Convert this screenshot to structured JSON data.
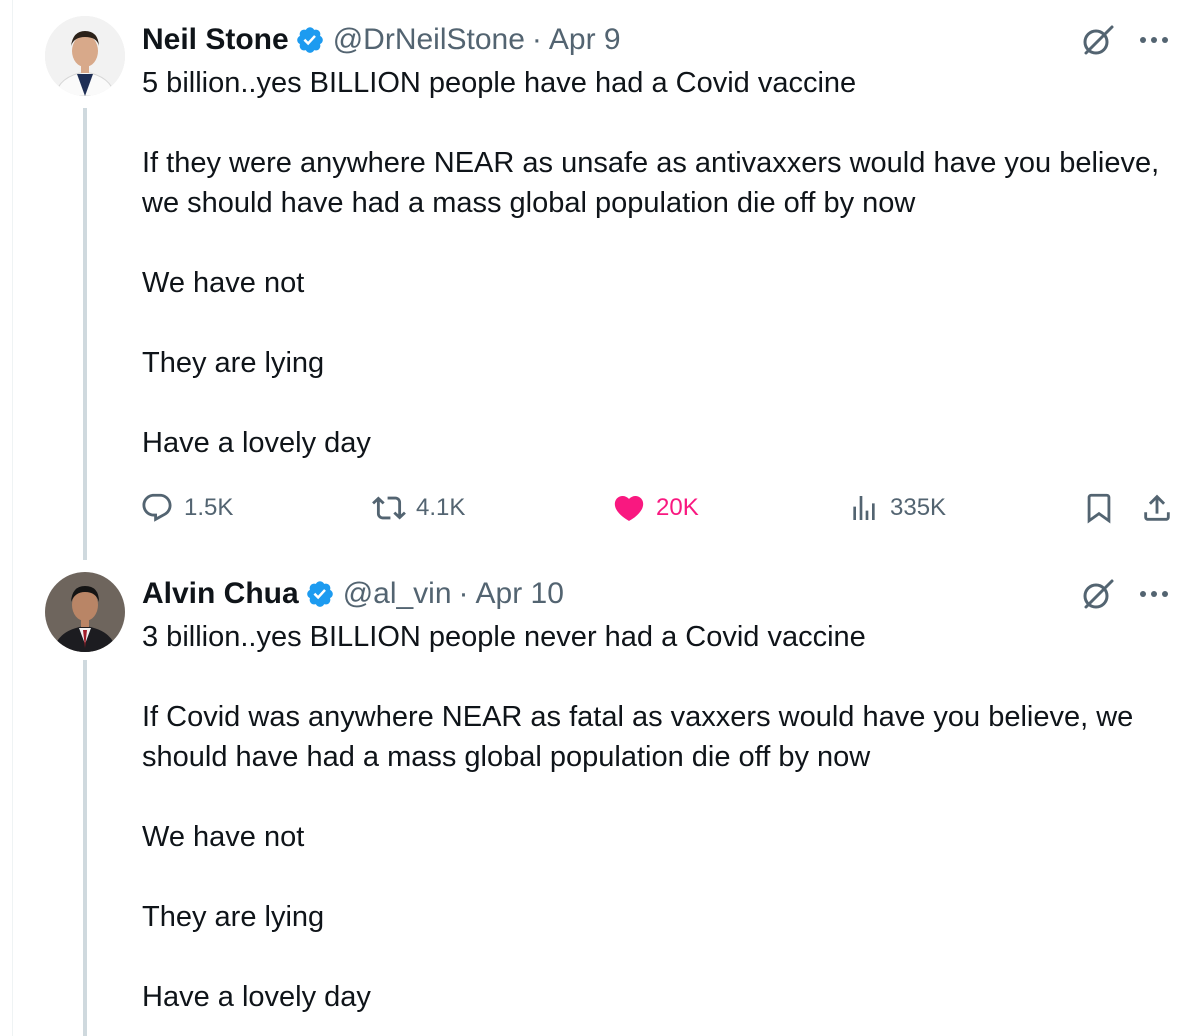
{
  "tweets": [
    {
      "author": {
        "name": "Neil Stone",
        "handle": "@DrNeilStone",
        "verified": true
      },
      "date": "Apr 9",
      "text": "5 billion..yes BILLION people have had a Covid vaccine\n\nIf they were anywhere NEAR as unsafe as antivaxxers would have you believe, we should have had a mass global population die off by now\n\nWe have not\n\nThey are lying\n\nHave a lovely day",
      "stats": {
        "replies": "1.5K",
        "reposts": "4.1K",
        "likes": "20K",
        "views": "335K"
      },
      "liked": true
    },
    {
      "author": {
        "name": "Alvin Chua",
        "handle": "@al_vin",
        "verified": true
      },
      "date": "Apr 10",
      "text": "3 billion..yes BILLION people never had a Covid vaccine\n\nIf Covid was anywhere NEAR as fatal as vaxxers would have you believe, we should have had a mass global population die off by now\n\nWe have not\n\nThey are lying\n\nHave a lovely day"
    }
  ],
  "separator": "·",
  "icons": [
    "verified-badge-icon",
    "grok-icon",
    "more-icon",
    "reply-icon",
    "repost-icon",
    "like-icon",
    "views-icon",
    "bookmark-icon",
    "share-icon"
  ],
  "colors": {
    "text": "#0f1419",
    "secondary": "#536471",
    "verified": "#1d9bf0",
    "like": "#f91880",
    "thread_line": "#cfd9de"
  }
}
